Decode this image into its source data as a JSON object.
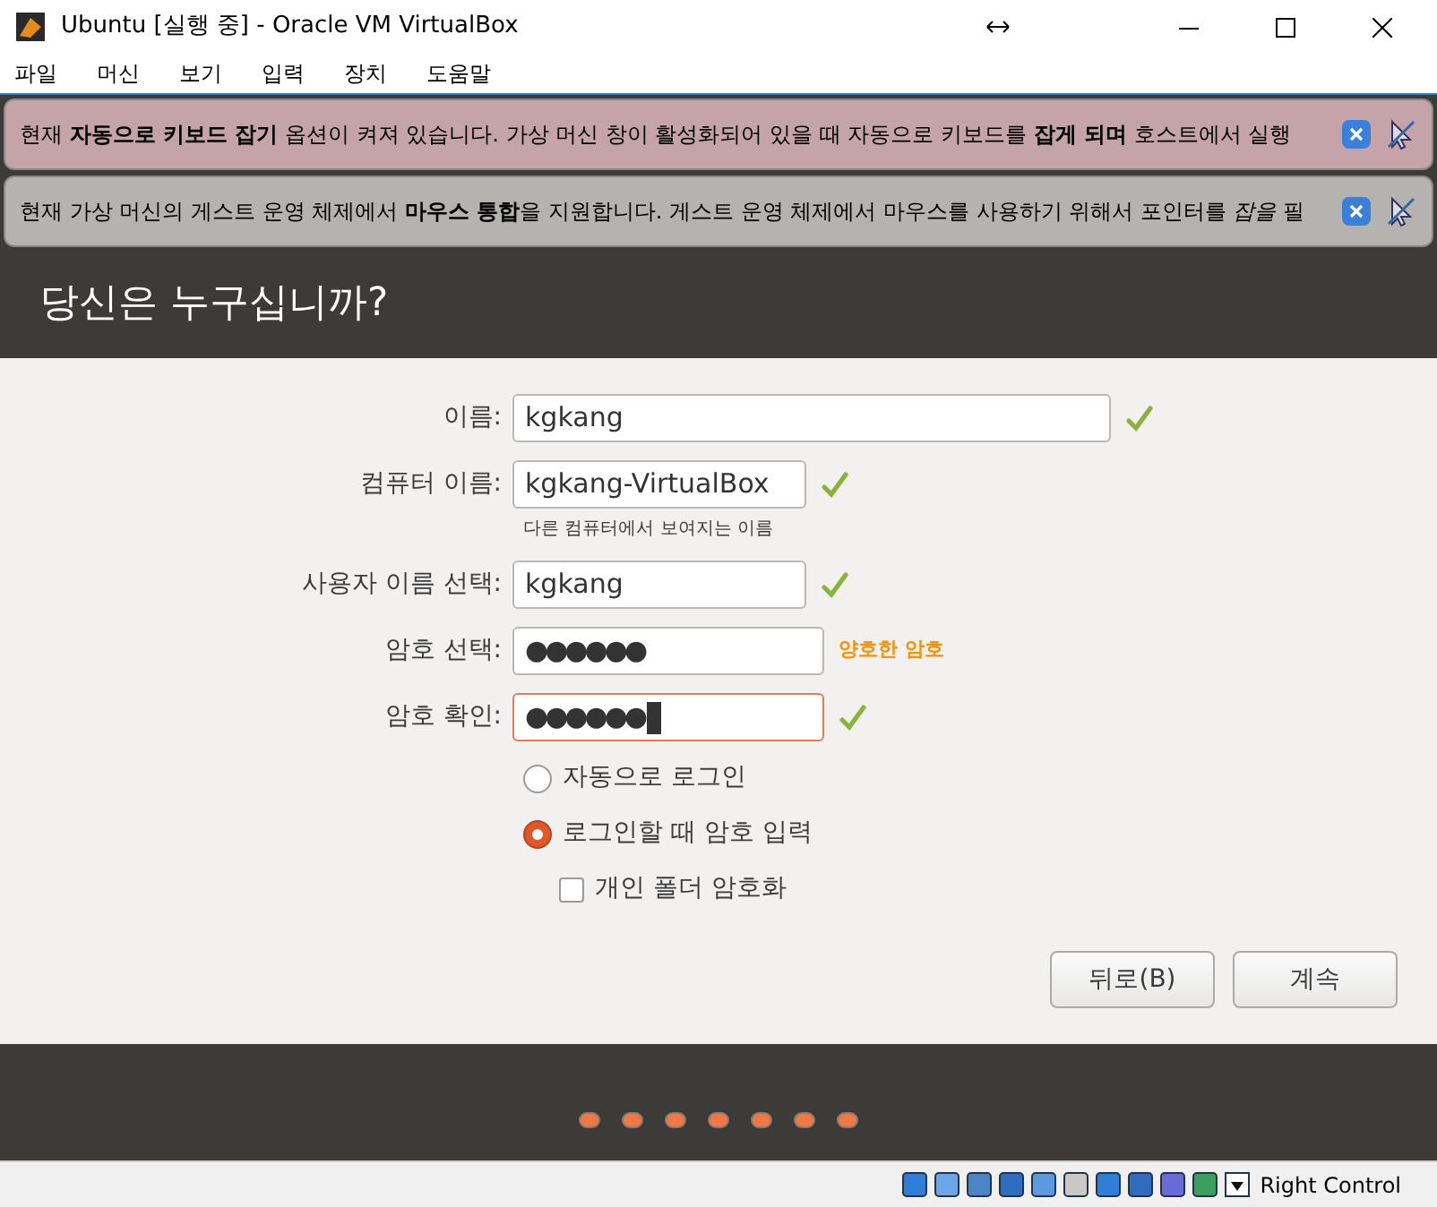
{
  "window": {
    "title": "Ubuntu [실행 중] - Oracle VM VirtualBox"
  },
  "menu": [
    "파일",
    "머신",
    "보기",
    "입력",
    "장치",
    "도움말"
  ],
  "notifications": [
    {
      "text": "현재 **자동으로 키보드 잡기** 옵션이 켜져 있습니다. 가상 머신 창이 활성화되어 있을 때 자동으로 키보드를 **잡게 되며** 호스트에서 실행"
    },
    {
      "text": "현재 가상 머신의 게스트 운영 체제에서 **마우스 통합**을 지원합니다. 게스트 운영 체제에서 마우스를 사용하기 위해서 포인터를 *잡을* 필"
    }
  ],
  "heading": "당신은 누구십니까?",
  "fields": [
    {
      "kind": "wide",
      "label": "이름:",
      "value": "kgkang",
      "valid": true,
      "focused": false
    },
    {
      "kind": "text",
      "label": "컴퓨터 이름:",
      "value": "kgkang-VirtualBox",
      "valid": true,
      "focused": false,
      "hint": "다른 컴퓨터에서 보여지는 이름"
    },
    {
      "kind": "text",
      "label": "사용자 이름 선택:",
      "value": "kgkang",
      "valid": true,
      "focused": false
    },
    {
      "kind": "password",
      "label": "암호 선택:",
      "value": "●●●●●●",
      "valid": false,
      "focused": false,
      "strength": "양호한 암호"
    },
    {
      "kind": "password",
      "label": "암호 확인:",
      "value": "●●●●●●",
      "valid": true,
      "focused": true
    }
  ],
  "login_options": [
    {
      "label": "자동으로 로그인",
      "selected": false
    },
    {
      "label": "로그인할 때 암호 입력",
      "selected": true
    }
  ],
  "encrypt_home": {
    "label": "개인 폴더 암호화",
    "checked": false
  },
  "buttons": [
    "뒤로(B)",
    "계속"
  ],
  "status_bar": {
    "host_key": "Right Control"
  }
}
